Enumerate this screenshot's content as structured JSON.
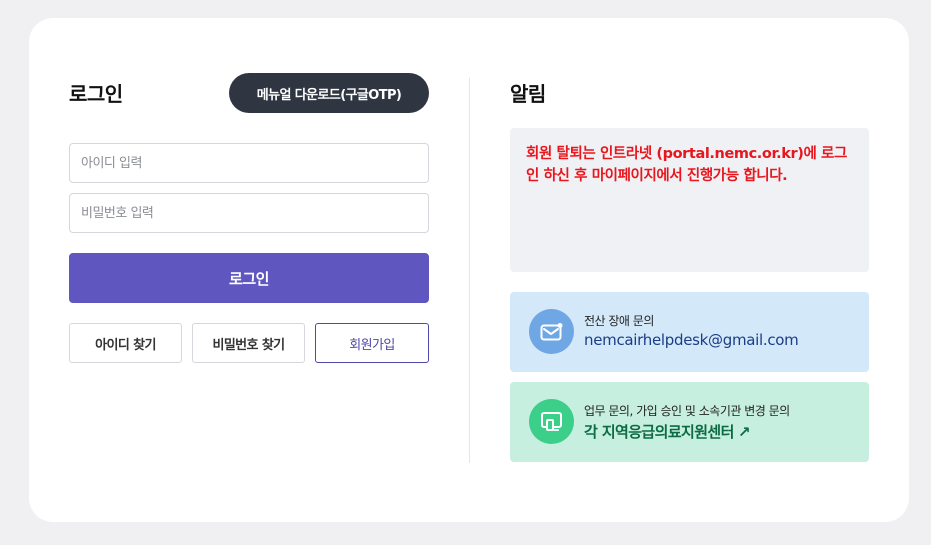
{
  "login": {
    "title": "로그인",
    "manual_button": "메뉴얼 다운로드(구글OTP)",
    "id_placeholder": "아이디 입력",
    "password_placeholder": "비밀번호 입력",
    "login_button": "로그인",
    "find_id_button": "아이디 찾기",
    "find_password_button": "비밀번호 찾기",
    "signup_button": "회원가입"
  },
  "notice": {
    "title": "알림",
    "message": "회원 탈퇴는 인트라넷 (portal.nemc.or.kr)에 로그인 하신 후 마이페이지에서 진행가능 합니다.",
    "message_color": "#e8161d"
  },
  "contacts": [
    {
      "label": "전산 장애 문의",
      "value": "nemcairhelpdesk@gmail.com",
      "icon": "mail-icon"
    },
    {
      "label": "업무 문의, 가입 승인 및 소속기관 변경 문의",
      "value": "각 지역응급의료지원센터",
      "icon": "device-icon",
      "link_icon": "↗"
    }
  ],
  "colors": {
    "primary": "#6056bf",
    "manual_button_bg": "#2f3642",
    "contact1_bg": "#d3e9fa",
    "contact2_bg": "#c6efdf"
  }
}
